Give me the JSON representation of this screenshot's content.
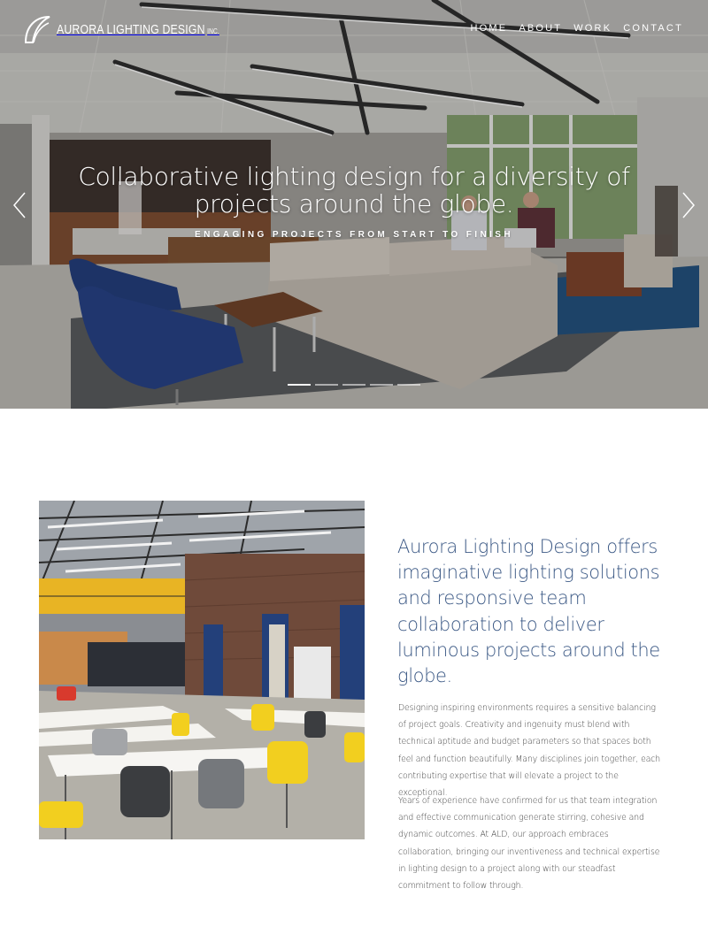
{
  "brand": {
    "name": "AURORA LIGHTING DESIGN",
    "suffix": "INC."
  },
  "nav": {
    "items": [
      "HOME",
      "ABOUT",
      "WORK",
      "CONTACT"
    ]
  },
  "hero": {
    "title": "Collaborative lighting design for a diversity of projects around the globe.",
    "subtitle": "ENGAGING PROJECTS FROM START TO FINISH",
    "slide_count": 5,
    "active_slide": 1
  },
  "about": {
    "headline": "Aurora Lighting Design offers imaginative lighting solutions and responsive team collaboration to deliver luminous projects around the globe.",
    "paragraphs": [
      "Designing inspiring environments requires a sensitive balancing of project goals. Creativity and ingenuity must blend with technical aptitude and budget parameters so that spaces both feel and function beautifully. Many disciplines join together, each contributing expertise that will elevate a project to the exceptional.",
      "Years of experience have confirmed for us that team integration and effective communication generate stirring, cohesive and dynamic outcomes. At ALD, our approach embraces collaboration, bringing our inventiveness and technical expertise in lighting design to a project along with our steadfast commitment to follow through."
    ]
  },
  "colors": {
    "headline": "#3d5a86",
    "body_text": "#3a3a3a",
    "nav_text": "#ffffff"
  },
  "icons": {
    "logo": "aurora-arc-logo-icon",
    "prev": "chevron-left-icon",
    "next": "chevron-right-icon"
  }
}
